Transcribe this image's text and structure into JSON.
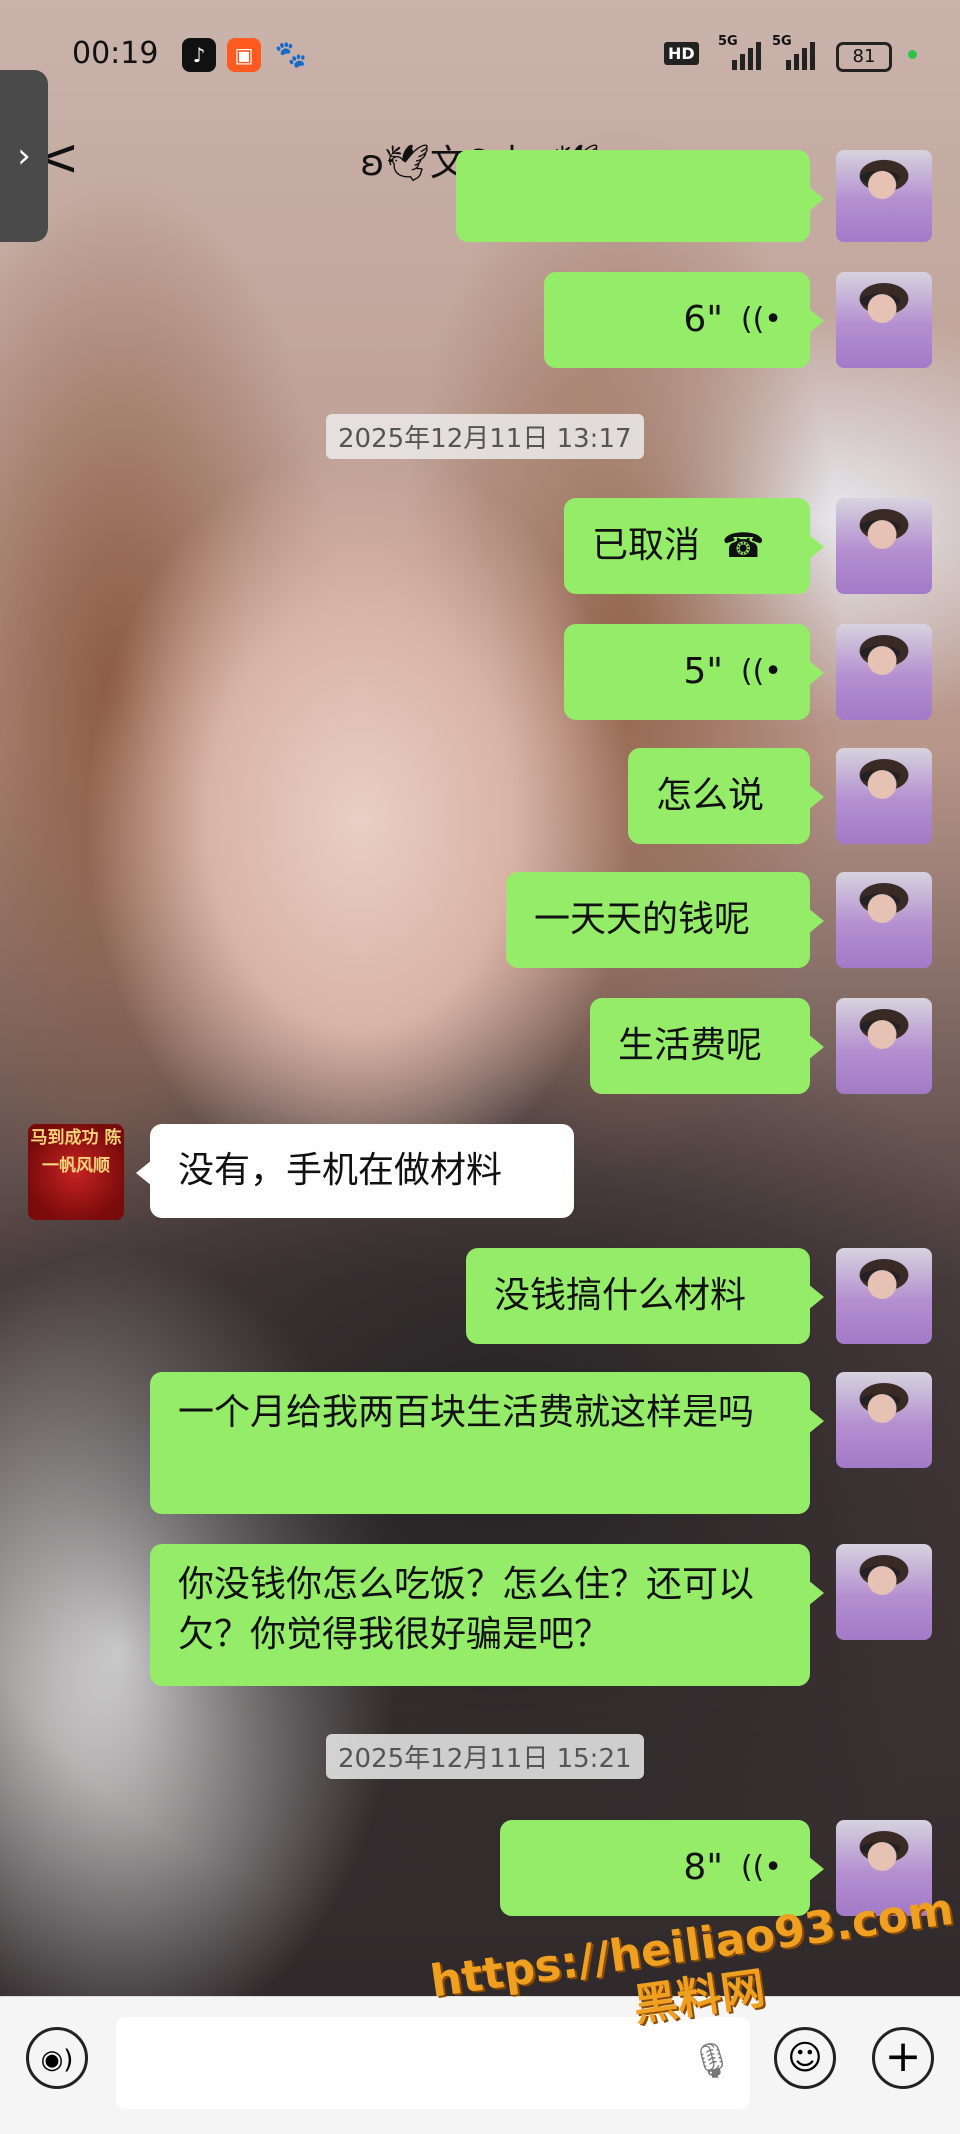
{
  "status_bar": {
    "time": "00:19",
    "network_1": "5G",
    "network_2": "5G",
    "hd_label": "HD",
    "battery": "81",
    "battery_dot_color": "#2ec24a",
    "apps": [
      "tiktok-icon",
      "kuaishou-icon",
      "baidu-paw-icon"
    ]
  },
  "header": {
    "back_handle_glyph": "›",
    "back_glyph": "<",
    "title": "ʚ🕊文&杰ʚ🕊",
    "more_glyph": "..."
  },
  "messages": [
    {
      "sender": "me",
      "type": "voice",
      "duration": "6\"",
      "wave": "((•"
    },
    {
      "type": "timestamp",
      "text": "2025年12月11日 13:17"
    },
    {
      "sender": "me",
      "type": "call",
      "text": "已取消",
      "icon": "hangup-icon"
    },
    {
      "sender": "me",
      "type": "voice",
      "duration": "5\"",
      "wave": "((•"
    },
    {
      "sender": "me",
      "type": "text",
      "text": "怎么说"
    },
    {
      "sender": "me",
      "type": "text",
      "text": "一天天的钱呢"
    },
    {
      "sender": "me",
      "type": "text",
      "text": "生活费呢"
    },
    {
      "sender": "them",
      "type": "text",
      "text": "没有，手机在做材料",
      "avatar_text": "马到成功 陈 一帆风顺"
    },
    {
      "sender": "me",
      "type": "text",
      "text": "没钱搞什么材料"
    },
    {
      "sender": "me",
      "type": "text",
      "text": "一个月给我两百块生活费就这样是吗"
    },
    {
      "sender": "me",
      "type": "text",
      "text": "你没钱你怎么吃饭？怎么住？还可以欠？你觉得我很好骗是吧？"
    },
    {
      "type": "timestamp",
      "text": "2025年12月11日 15:21"
    },
    {
      "sender": "me",
      "type": "voice",
      "duration": "8\"",
      "wave": "((•"
    }
  ],
  "input_bar": {
    "voice_toggle_icon": "voice-toggle-icon",
    "mic_icon": "microphone-icon",
    "emoji_icon": "emoji-icon",
    "plus_icon": "plus-icon",
    "voice_glyph": "◉)",
    "mic_glyph": "🎙",
    "emoji_glyph": "☺",
    "plus_glyph": "+"
  },
  "watermark": {
    "line1": "https://heiliao93.com",
    "line2": "黑料网"
  },
  "colors": {
    "my_bubble": "#95ec69",
    "their_bubble": "#ffffff"
  }
}
